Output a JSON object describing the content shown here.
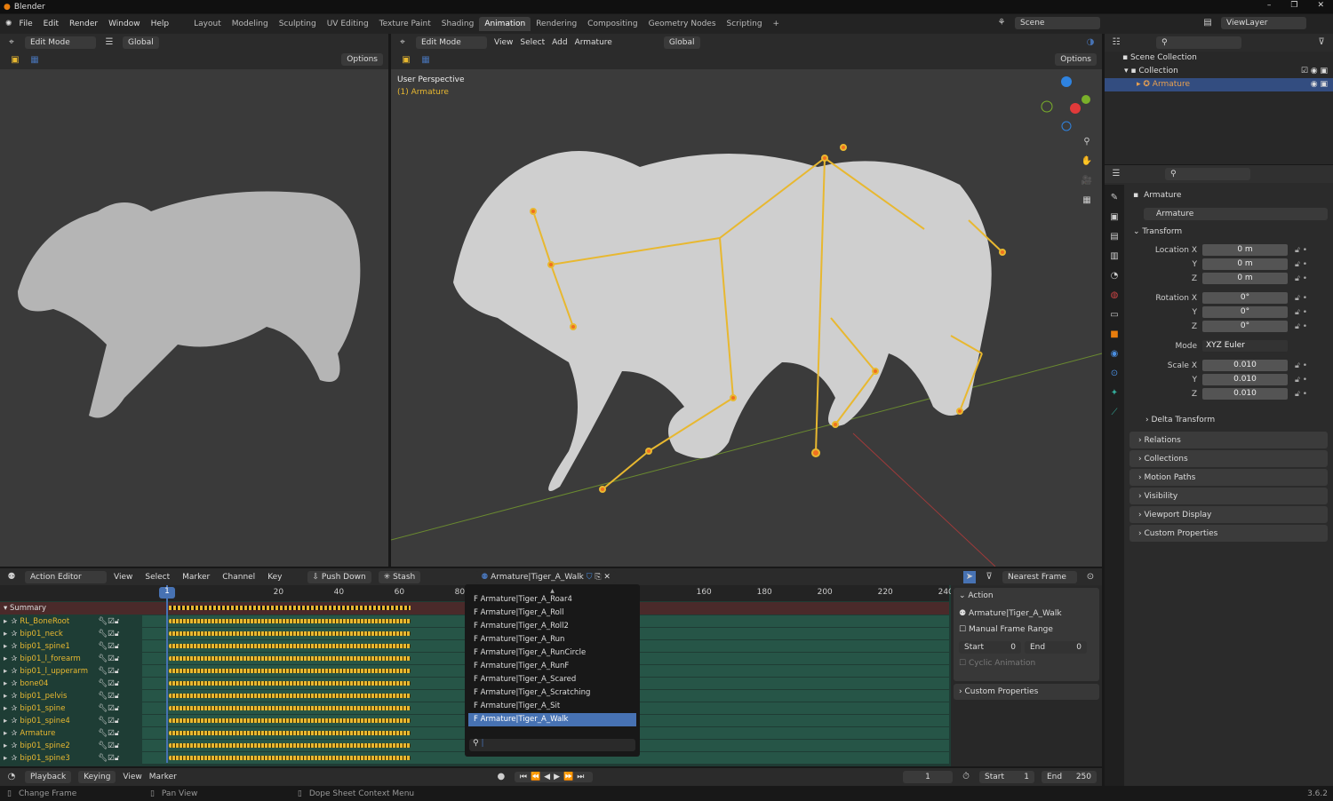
{
  "window": {
    "title": "Blender",
    "controls": [
      "–",
      "❐",
      "✕"
    ]
  },
  "menu": [
    "File",
    "Edit",
    "Render",
    "Window",
    "Help"
  ],
  "workspaces": [
    "Layout",
    "Modeling",
    "Sculpting",
    "UV Editing",
    "Texture Paint",
    "Shading",
    "Animation",
    "Rendering",
    "Compositing",
    "Geometry Nodes",
    "Scripting",
    "+"
  ],
  "active_workspace": "Animation",
  "scene": "Scene",
  "view_layer": "ViewLayer",
  "left_view": {
    "mode": "Edit Mode",
    "orientation": "Global",
    "options": "Options"
  },
  "main_view": {
    "mode": "Edit Mode",
    "menus": [
      "View",
      "Select",
      "Add",
      "Armature"
    ],
    "orientation": "Global",
    "options": "Options",
    "perspective": "User Perspective",
    "object": "(1) Armature"
  },
  "outliner": {
    "items": [
      "Scene Collection",
      "Collection",
      "Armature"
    ]
  },
  "properties": {
    "object": "Armature",
    "data_name": "Armature",
    "transform": "Transform",
    "location": [
      {
        "l": "Location X",
        "v": "0 m"
      },
      {
        "l": "Y",
        "v": "0 m"
      },
      {
        "l": "Z",
        "v": "0 m"
      }
    ],
    "rotation": [
      {
        "l": "Rotation X",
        "v": "0°"
      },
      {
        "l": "Y",
        "v": "0°"
      },
      {
        "l": "Z",
        "v": "0°"
      }
    ],
    "mode_label": "Mode",
    "mode": "XYZ Euler",
    "scale": [
      {
        "l": "Scale X",
        "v": "0.010"
      },
      {
        "l": "Y",
        "v": "0.010"
      },
      {
        "l": "Z",
        "v": "0.010"
      }
    ],
    "delta": "Delta Transform",
    "panels": [
      "Relations",
      "Collections",
      "Motion Paths",
      "Visibility",
      "Viewport Display",
      "Custom Properties"
    ]
  },
  "dopesheet": {
    "editor": "Action Editor",
    "menus": [
      "View",
      "Select",
      "Marker",
      "Channel",
      "Key"
    ],
    "push_down": "Push Down",
    "stash": "Stash",
    "action": "Armature|Tiger_A_Walk",
    "snap": "Nearest Frame",
    "current_frame": "1",
    "ticks": [
      "20",
      "40",
      "60",
      "80",
      "160",
      "180",
      "200",
      "220",
      "240"
    ],
    "summary": "Summary",
    "channels": [
      "RL_BoneRoot",
      "bip01_neck",
      "bip01_spine1",
      "bip01_l_forearm",
      "bip01_l_upperarm",
      "bone04",
      "bip01_pelvis",
      "bip01_spine",
      "bip01_spine4",
      "Armature",
      "bip01_spine2",
      "bip01_spine3"
    ],
    "action_list": [
      "F Armature|Tiger_A_Roar4",
      "F Armature|Tiger_A_Roll",
      "F Armature|Tiger_A_Roll2",
      "F Armature|Tiger_A_Run",
      "F Armature|Tiger_A_RunCircle",
      "F Armature|Tiger_A_RunF",
      "F Armature|Tiger_A_Scared",
      "F Armature|Tiger_A_Scratching",
      "F Armature|Tiger_A_Sit",
      "F Armature|Tiger_A_Walk"
    ],
    "selected_action_index": 9,
    "sidebar": {
      "header": "Action",
      "action": "Armature|Tiger_A_Walk",
      "manual": "Manual Frame Range",
      "start_l": "Start",
      "start": "0",
      "end_l": "End",
      "end": "0",
      "cyclic": "Cyclic Animation",
      "custom": "Custom Properties"
    }
  },
  "timeline": {
    "menus": [
      "Playback",
      "Keying",
      "View",
      "Marker"
    ],
    "frame": "1",
    "start_l": "Start",
    "start": "1",
    "end_l": "End",
    "end": "250"
  },
  "status": {
    "left": "Change Frame",
    "mid": "Pan View",
    "right": "Dope Sheet Context Menu",
    "version": "3.6.2"
  },
  "colors": {
    "accent": "#4772b3",
    "keyframe": "#e8b830",
    "bone": "#f0a020",
    "channel_bg": "#265547",
    "summary_bg": "#4a2a2a"
  }
}
